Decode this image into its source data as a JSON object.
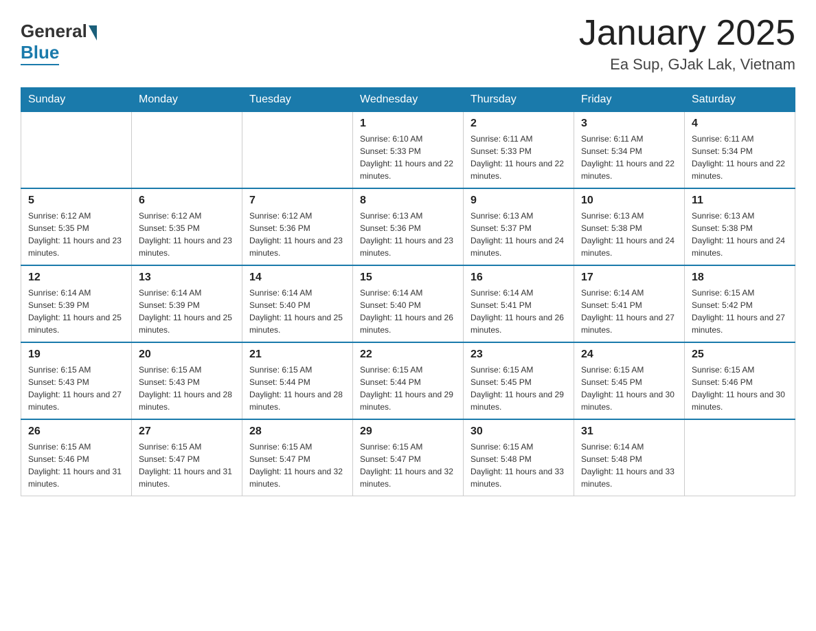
{
  "header": {
    "logo": {
      "general": "General",
      "blue": "Blue"
    },
    "title": "January 2025",
    "location": "Ea Sup, GJak Lak, Vietnam"
  },
  "days_of_week": [
    "Sunday",
    "Monday",
    "Tuesday",
    "Wednesday",
    "Thursday",
    "Friday",
    "Saturday"
  ],
  "weeks": [
    {
      "days": [
        {
          "date": "",
          "info": ""
        },
        {
          "date": "",
          "info": ""
        },
        {
          "date": "",
          "info": ""
        },
        {
          "date": "1",
          "info": "Sunrise: 6:10 AM\nSunset: 5:33 PM\nDaylight: 11 hours and 22 minutes."
        },
        {
          "date": "2",
          "info": "Sunrise: 6:11 AM\nSunset: 5:33 PM\nDaylight: 11 hours and 22 minutes."
        },
        {
          "date": "3",
          "info": "Sunrise: 6:11 AM\nSunset: 5:34 PM\nDaylight: 11 hours and 22 minutes."
        },
        {
          "date": "4",
          "info": "Sunrise: 6:11 AM\nSunset: 5:34 PM\nDaylight: 11 hours and 22 minutes."
        }
      ]
    },
    {
      "days": [
        {
          "date": "5",
          "info": "Sunrise: 6:12 AM\nSunset: 5:35 PM\nDaylight: 11 hours and 23 minutes."
        },
        {
          "date": "6",
          "info": "Sunrise: 6:12 AM\nSunset: 5:35 PM\nDaylight: 11 hours and 23 minutes."
        },
        {
          "date": "7",
          "info": "Sunrise: 6:12 AM\nSunset: 5:36 PM\nDaylight: 11 hours and 23 minutes."
        },
        {
          "date": "8",
          "info": "Sunrise: 6:13 AM\nSunset: 5:36 PM\nDaylight: 11 hours and 23 minutes."
        },
        {
          "date": "9",
          "info": "Sunrise: 6:13 AM\nSunset: 5:37 PM\nDaylight: 11 hours and 24 minutes."
        },
        {
          "date": "10",
          "info": "Sunrise: 6:13 AM\nSunset: 5:38 PM\nDaylight: 11 hours and 24 minutes."
        },
        {
          "date": "11",
          "info": "Sunrise: 6:13 AM\nSunset: 5:38 PM\nDaylight: 11 hours and 24 minutes."
        }
      ]
    },
    {
      "days": [
        {
          "date": "12",
          "info": "Sunrise: 6:14 AM\nSunset: 5:39 PM\nDaylight: 11 hours and 25 minutes."
        },
        {
          "date": "13",
          "info": "Sunrise: 6:14 AM\nSunset: 5:39 PM\nDaylight: 11 hours and 25 minutes."
        },
        {
          "date": "14",
          "info": "Sunrise: 6:14 AM\nSunset: 5:40 PM\nDaylight: 11 hours and 25 minutes."
        },
        {
          "date": "15",
          "info": "Sunrise: 6:14 AM\nSunset: 5:40 PM\nDaylight: 11 hours and 26 minutes."
        },
        {
          "date": "16",
          "info": "Sunrise: 6:14 AM\nSunset: 5:41 PM\nDaylight: 11 hours and 26 minutes."
        },
        {
          "date": "17",
          "info": "Sunrise: 6:14 AM\nSunset: 5:41 PM\nDaylight: 11 hours and 27 minutes."
        },
        {
          "date": "18",
          "info": "Sunrise: 6:15 AM\nSunset: 5:42 PM\nDaylight: 11 hours and 27 minutes."
        }
      ]
    },
    {
      "days": [
        {
          "date": "19",
          "info": "Sunrise: 6:15 AM\nSunset: 5:43 PM\nDaylight: 11 hours and 27 minutes."
        },
        {
          "date": "20",
          "info": "Sunrise: 6:15 AM\nSunset: 5:43 PM\nDaylight: 11 hours and 28 minutes."
        },
        {
          "date": "21",
          "info": "Sunrise: 6:15 AM\nSunset: 5:44 PM\nDaylight: 11 hours and 28 minutes."
        },
        {
          "date": "22",
          "info": "Sunrise: 6:15 AM\nSunset: 5:44 PM\nDaylight: 11 hours and 29 minutes."
        },
        {
          "date": "23",
          "info": "Sunrise: 6:15 AM\nSunset: 5:45 PM\nDaylight: 11 hours and 29 minutes."
        },
        {
          "date": "24",
          "info": "Sunrise: 6:15 AM\nSunset: 5:45 PM\nDaylight: 11 hours and 30 minutes."
        },
        {
          "date": "25",
          "info": "Sunrise: 6:15 AM\nSunset: 5:46 PM\nDaylight: 11 hours and 30 minutes."
        }
      ]
    },
    {
      "days": [
        {
          "date": "26",
          "info": "Sunrise: 6:15 AM\nSunset: 5:46 PM\nDaylight: 11 hours and 31 minutes."
        },
        {
          "date": "27",
          "info": "Sunrise: 6:15 AM\nSunset: 5:47 PM\nDaylight: 11 hours and 31 minutes."
        },
        {
          "date": "28",
          "info": "Sunrise: 6:15 AM\nSunset: 5:47 PM\nDaylight: 11 hours and 32 minutes."
        },
        {
          "date": "29",
          "info": "Sunrise: 6:15 AM\nSunset: 5:47 PM\nDaylight: 11 hours and 32 minutes."
        },
        {
          "date": "30",
          "info": "Sunrise: 6:15 AM\nSunset: 5:48 PM\nDaylight: 11 hours and 33 minutes."
        },
        {
          "date": "31",
          "info": "Sunrise: 6:14 AM\nSunset: 5:48 PM\nDaylight: 11 hours and 33 minutes."
        },
        {
          "date": "",
          "info": ""
        }
      ]
    }
  ]
}
